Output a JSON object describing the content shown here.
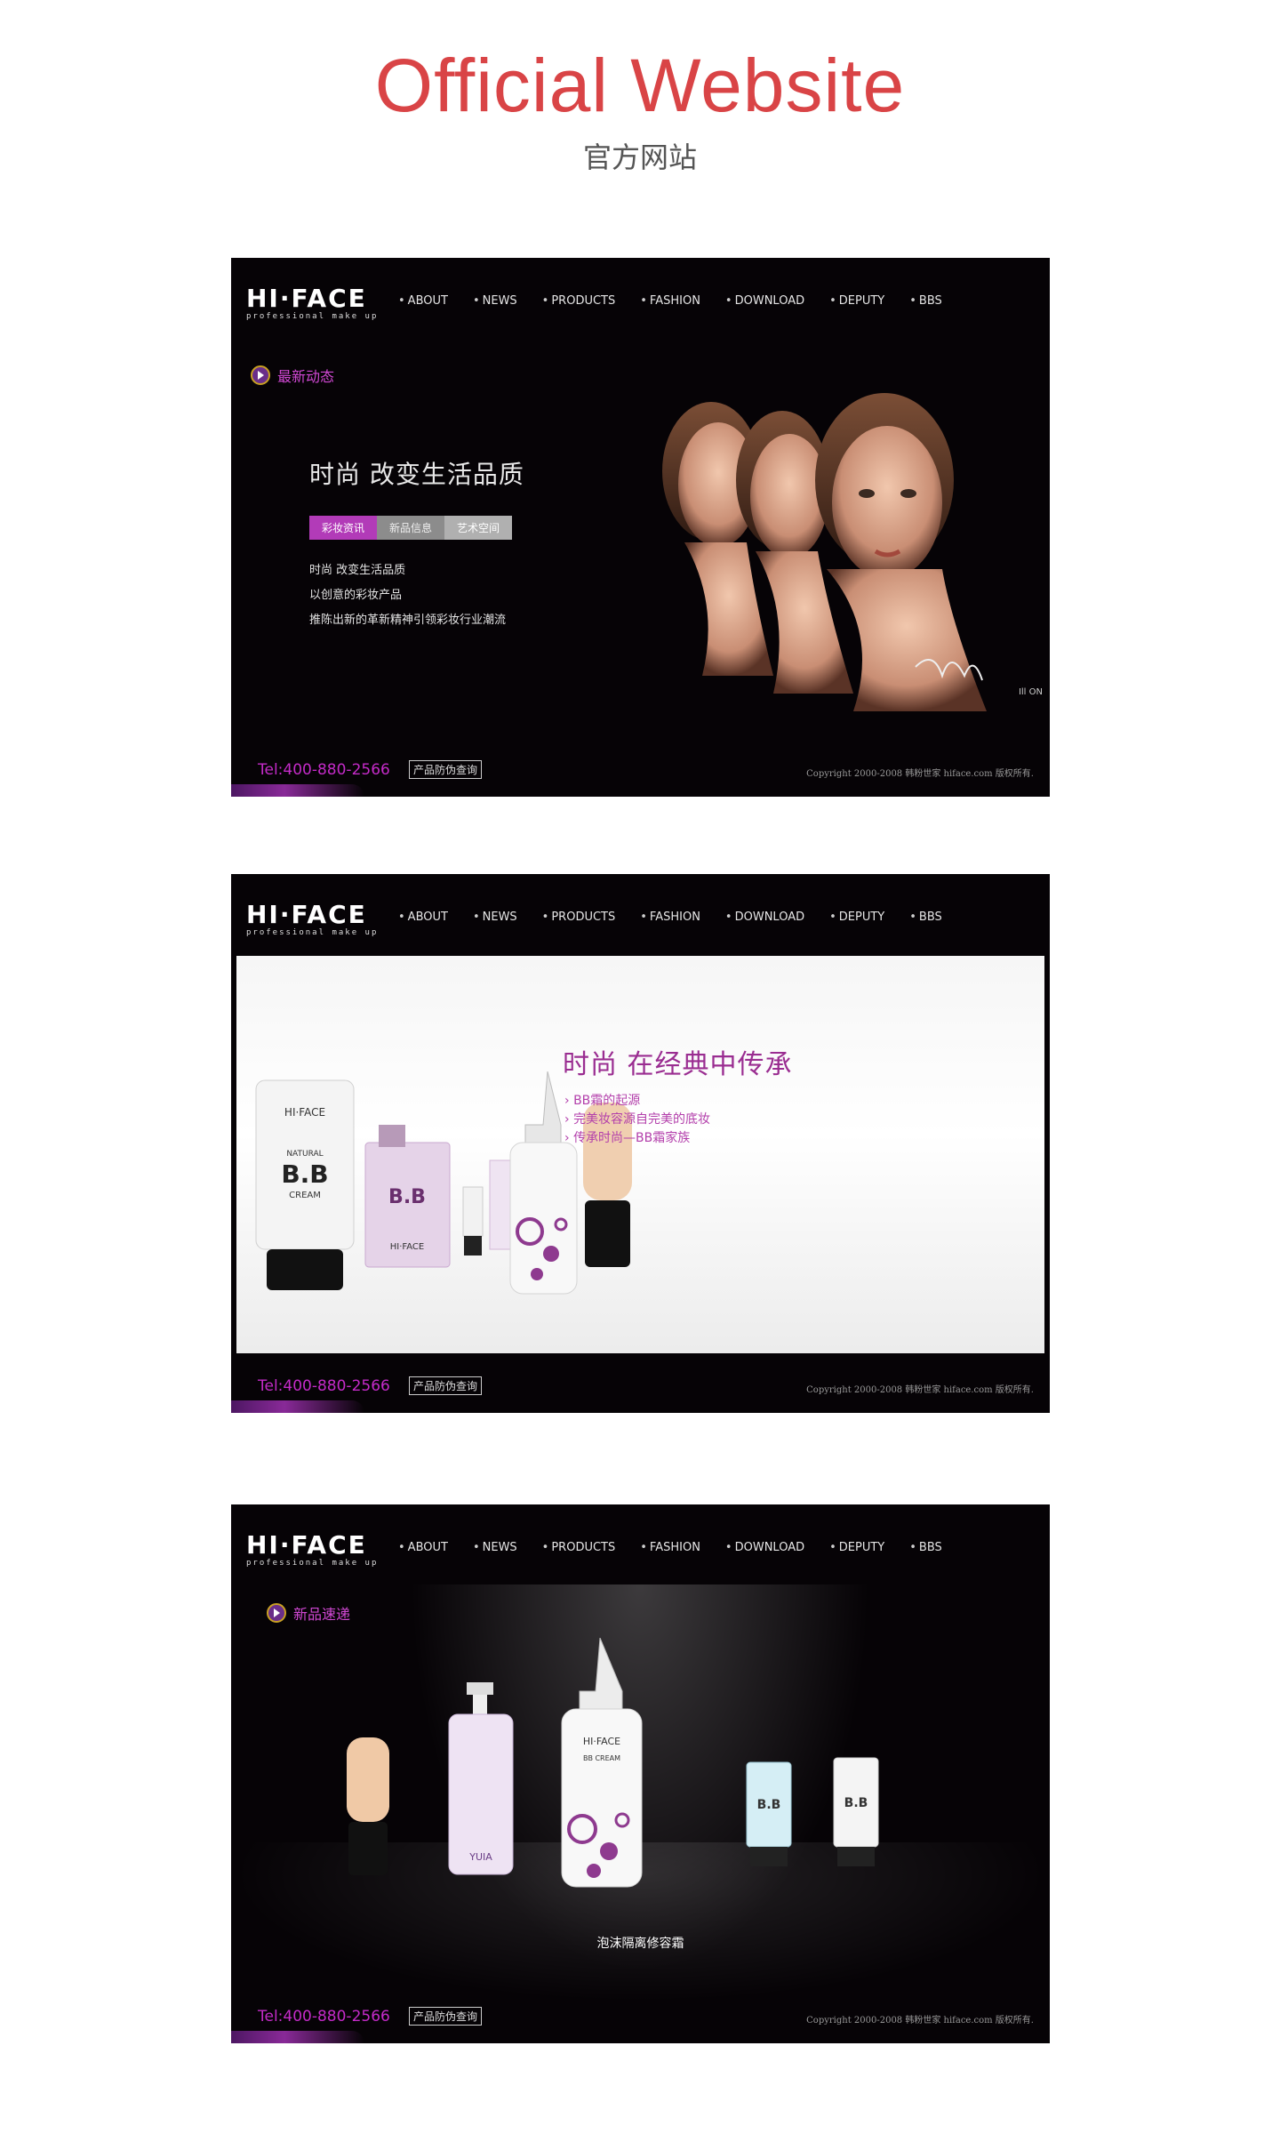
{
  "header": {
    "title": "Official Website",
    "subtitle": "官方网站"
  },
  "site": {
    "logo": "HI·FACE",
    "logo_tagline": "professional make up",
    "nav": [
      "ABOUT",
      "NEWS",
      "PRODUCTS",
      "FASHION",
      "DOWNLOAD",
      "DEPUTY",
      "BBS"
    ],
    "tel": "Tel:400-880-2566",
    "verify": "产品防伪查询",
    "copyright": "Copyright 2000-2008 韩粉世家 hiface.com 版权所有."
  },
  "shot1": {
    "tag": "最新动态",
    "headline": "时尚  改变生活品质",
    "tabs": [
      "彩妆资讯",
      "新品信息",
      "艺术空间"
    ],
    "lines": [
      "时尚 改变生活品质",
      "以创意的彩妆产品",
      "推陈出新的革新精神引领彩妆行业潮流"
    ],
    "brand_mark": "Ill ON"
  },
  "shot2": {
    "headline": "时尚  在经典中传承",
    "links": [
      "BB霜的起源",
      "完美妆容源自完美的底妆",
      "传承时尚—BB霜家族"
    ],
    "product_text": {
      "natural": "NATURAL",
      "bb": "B.B",
      "cream": "CREAM",
      "brand": "HI·FACE"
    }
  },
  "shot3": {
    "tag": "新品速递",
    "caption": "泡沫隔离修容霜",
    "product_text": {
      "bb": "B.B",
      "yuia": "YUIA",
      "bbcream": "BB CREAM",
      "brand": "HI·FACE"
    }
  },
  "colors": {
    "title_red": "#d94446",
    "accent_purple": "#c42bc8",
    "bg_dark": "#060306"
  }
}
